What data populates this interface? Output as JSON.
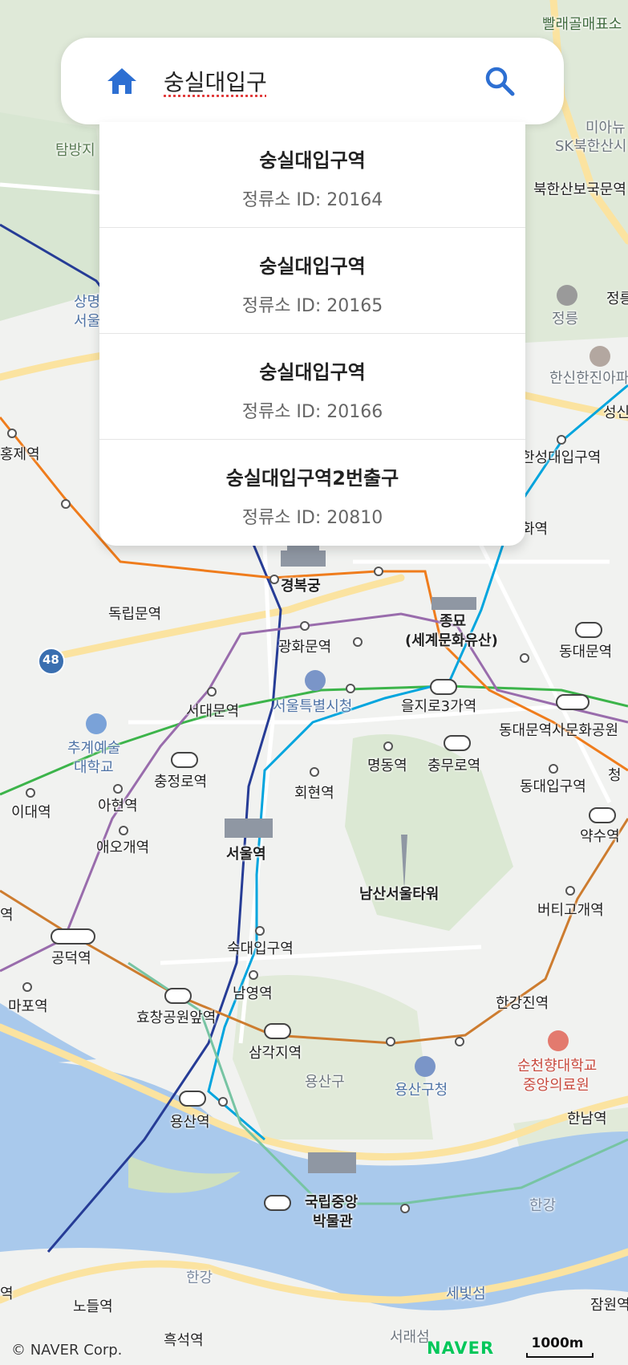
{
  "search": {
    "query": "숭실대입구",
    "home_icon": "home-icon",
    "search_icon": "search-icon"
  },
  "results": [
    {
      "title": "숭실대입구역",
      "subtitle": "정류소 ID: 20164"
    },
    {
      "title": "숭실대입구역",
      "subtitle": "정류소 ID: 20165"
    },
    {
      "title": "숭실대입구역",
      "subtitle": "정류소 ID: 20166"
    },
    {
      "title": "숭실대입구역2번출구",
      "subtitle": "정류소 ID: 20810"
    }
  ],
  "map": {
    "labels": {
      "bbalae": "빨래골매표소",
      "miahyu": "미아뉴",
      "sk_bukhansan": "SK북한산시",
      "bukhansan_bogukmun": "북한산보국문역",
      "tangbangji": "탐방지",
      "sangmyung": "상명",
      "seoul_l": "서울",
      "jeongneung_l": "정릉",
      "jeongneung_r": "정릉",
      "hanshin": "한신한진아파",
      "seongsin": "성신",
      "hongje": "홍제역",
      "hansung": "한성대입구역",
      "hyehwa": "화역",
      "gyeongbokgung": "경복궁",
      "dongnimmun": "독립문역",
      "jongmyo_1": "종묘",
      "jongmyo_2": "(세계문화유산)",
      "gwanghwamun": "광화문역",
      "dongdaemun": "동대문역",
      "route48": "48",
      "seodaemun": "서대문역",
      "seoul_city_hall": "서울특별시청",
      "euljiro3ga": "을지로3가역",
      "ddp": "동대문역사문화공원",
      "chugye_1": "추계예술",
      "chugye_2": "대학교",
      "ahyeon": "아현역",
      "chungjeongno": "충정로역",
      "myeongdong": "명동역",
      "chungmuro": "충무로역",
      "dongdae_ipgu": "동대입구역",
      "edae": "이대역",
      "hoehyeon": "회현역",
      "cheong": "청",
      "aeogae": "애오개역",
      "seoul_station": "서울역",
      "yaksu": "약수역",
      "namsan_tower": "남산서울타워",
      "beoti": "버티고개역",
      "mapo_l": "역",
      "sookmyung": "숙대입구역",
      "gongdeok": "공덕역",
      "mapo": "마포역",
      "namyeong": "남영역",
      "hyochang": "효창공원앞역",
      "hangangjin": "한강진역",
      "samgakji": "삼각지역",
      "yongsangu": "용산구",
      "yongsan_office": "용산구청",
      "soonchunhyang_1": "순천향대학교",
      "soonchunhyang_2": "중앙의료원",
      "yongsan_station": "용산역",
      "hannam": "한남역",
      "museum_1": "국립중앙",
      "museum_2": "박물관",
      "hangang_r": "한강",
      "hangang_b": "한강",
      "nodeul": "노들역",
      "sebitseom": "세빛섬",
      "jamwon": "잠원역",
      "heukseok": "흑석역",
      "seorae": "서래섬",
      "left_edge": "역"
    }
  },
  "footer": {
    "credit": "© NAVER Corp.",
    "logo": "NAVER",
    "scale": "1000m"
  },
  "colors": {
    "accent": "#2d6fd2",
    "line1": "#263c96",
    "line2": "#3cb44a",
    "line3": "#ef7c1c",
    "line4": "#00a5de",
    "line5": "#996cac",
    "line6": "#cd7c2f",
    "gyeongui": "#77c4a3",
    "river": "#a9c9ec"
  }
}
